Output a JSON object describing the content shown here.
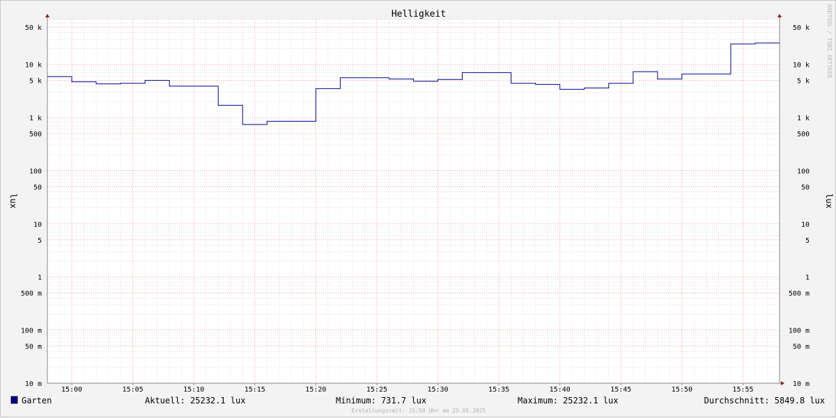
{
  "chart_data": {
    "type": "line",
    "title": "Helligkeit",
    "ylabel": "lux",
    "ylabel_right": "lux",
    "y_scale": "log",
    "ylim": [
      0.01,
      70000
    ],
    "xlim": [
      "14:58",
      "15:58"
    ],
    "grid": true,
    "x_ticks": [
      "15:00",
      "15:05",
      "15:10",
      "15:15",
      "15:20",
      "15:25",
      "15:30",
      "15:35",
      "15:40",
      "15:45",
      "15:50",
      "15:55"
    ],
    "y_ticks": [
      {
        "value": 50000,
        "label": "50 k"
      },
      {
        "value": 10000,
        "label": "10 k"
      },
      {
        "value": 5000,
        "label": "5 k"
      },
      {
        "value": 1000,
        "label": "1 k"
      },
      {
        "value": 500,
        "label": "500"
      },
      {
        "value": 100,
        "label": "100"
      },
      {
        "value": 50,
        "label": "50"
      },
      {
        "value": 10,
        "label": "10"
      },
      {
        "value": 5,
        "label": "5"
      },
      {
        "value": 1,
        "label": "1"
      },
      {
        "value": 0.5,
        "label": "500 m"
      },
      {
        "value": 0.1,
        "label": "100 m"
      },
      {
        "value": 0.05,
        "label": "50 m"
      },
      {
        "value": 0.01,
        "label": "10 m"
      }
    ],
    "series": [
      {
        "name": "Garten",
        "color": "#00008b",
        "x": [
          "14:58",
          "15:00",
          "15:02",
          "15:04",
          "15:06",
          "15:08",
          "15:10",
          "15:12",
          "15:14",
          "15:16",
          "15:18",
          "15:20",
          "15:22",
          "15:24",
          "15:26",
          "15:28",
          "15:30",
          "15:32",
          "15:34",
          "15:36",
          "15:38",
          "15:40",
          "15:42",
          "15:44",
          "15:46",
          "15:48",
          "15:50",
          "15:52",
          "15:54",
          "15:56",
          "15:58"
        ],
        "values": [
          5900,
          4700,
          4300,
          4400,
          5000,
          3900,
          3900,
          1700,
          740,
          850,
          850,
          3500,
          5600,
          5600,
          5300,
          4800,
          5200,
          7000,
          7000,
          4400,
          4200,
          3400,
          3600,
          4400,
          7300,
          5300,
          6600,
          6600,
          24300,
          25232,
          25232
        ]
      }
    ],
    "legend": {
      "label": "Garten",
      "color": "#00008b",
      "current": "Aktuell: 25232.1 lux",
      "minimum": "Minimum: 731.7 lux",
      "maximum": "Maximum: 25232.1 lux",
      "average": "Durchschnitt: 5849.8 lux"
    },
    "footer": "Erstellungszeit: 15:58 Uhr am 25.05.2025",
    "watermark": "RRDTOOL / TOBI OETIKER"
  }
}
